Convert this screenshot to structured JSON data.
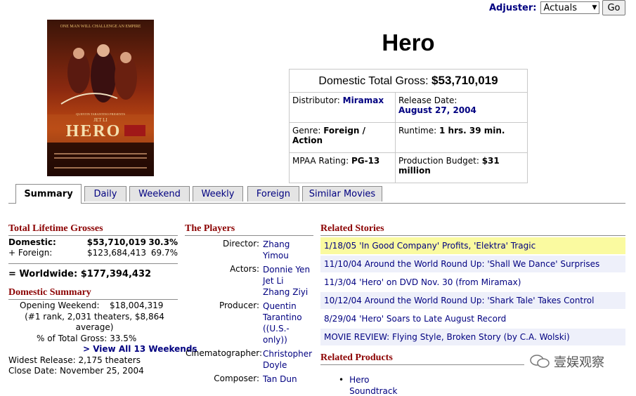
{
  "adjuster": {
    "label": "Adjuster:",
    "selected": "Actuals",
    "go": "Go"
  },
  "poster": {
    "tagline": "ONE MAN WILL CHALLENGE AN EMPIRE",
    "presenter": "QUENTIN TARANTINO PRESENTS",
    "star": "JET LI",
    "title": "HERO"
  },
  "title": "Hero",
  "info": {
    "gross_label": "Domestic Total Gross:",
    "gross_value": "$53,710,019",
    "distributor_label": "Distributor:",
    "distributor": "Miramax",
    "release_label": "Release Date:",
    "release": "August 27, 2004",
    "genre_label": "Genre:",
    "genre": "Foreign / Action",
    "runtime_label": "Runtime:",
    "runtime": "1 hrs. 39 min.",
    "mpaa_label": "MPAA Rating:",
    "mpaa": "PG-13",
    "budget_label": "Production Budget:",
    "budget": "$31 million"
  },
  "tabs": [
    "Summary",
    "Daily",
    "Weekend",
    "Weekly",
    "Foreign",
    "Similar Movies"
  ],
  "lifetime": {
    "header": "Total Lifetime Grosses",
    "domestic_label": "Domestic:",
    "domestic_value": "$53,710,019",
    "domestic_pct": "30.3%",
    "foreign_label": "+ Foreign:",
    "foreign_value": "$123,684,413",
    "foreign_pct": "69.7%",
    "worldwide": "= Worldwide: $177,394,432"
  },
  "domestic_summary": {
    "header": "Domestic Summary",
    "opening_label": "Opening Weekend:",
    "opening_value": "$18,004,319",
    "rank_line1": "(#1 rank, 2,031 theaters, $8,864",
    "rank_line2": "average)",
    "pct_total": "% of Total Gross: 33.5%",
    "view_all": "> View All 13 Weekends",
    "widest": "Widest Release: 2,175 theaters",
    "close": "Close Date: November 25, 2004"
  },
  "players": {
    "header": "The Players",
    "director_label": "Director:",
    "director": [
      "Zhang",
      "Yimou"
    ],
    "actors_label": "Actors:",
    "actors": [
      "Donnie Yen",
      "Jet Li",
      "Zhang Ziyi"
    ],
    "producer_label": "Producer:",
    "producer": [
      "Quentin",
      "Tarantino",
      "((U.S.-",
      "only))"
    ],
    "cinematographer_label": "Cinematographer:",
    "cinematographer": [
      "Christopher",
      "Doyle"
    ],
    "composer_label": "Composer:",
    "composer": "Tan Dun"
  },
  "stories": {
    "header": "Related Stories",
    "items": [
      "1/18/05 'In Good Company' Profits, 'Elektra' Tragic",
      "11/10/04 Around the World Round Up: 'Shall We Dance' Surprises",
      "11/3/04 'Hero' on DVD Nov. 30 (from Miramax)",
      "10/12/04 Around the World Round Up: 'Shark Tale' Takes Control",
      "8/29/04 'Hero' Soars to Late August Record",
      "MOVIE REVIEW: Flying Style, Broken Story (by C.A. Wolski)"
    ]
  },
  "products": {
    "header": "Related Products",
    "items": [
      "Hero",
      "Soundtrack"
    ]
  },
  "watermark": "壹娱观察",
  "colors": {
    "section_header": "#8b0000",
    "link": "#000080",
    "highlight": "#fafaa0",
    "alt_row": "#eef0fa"
  }
}
